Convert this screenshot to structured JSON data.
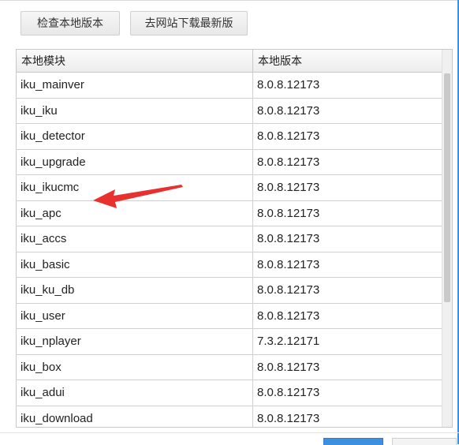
{
  "toolbar": {
    "check_local_label": "检查本地版本",
    "download_latest_label": "去网站下载最新版"
  },
  "table": {
    "columns": [
      "本地模块",
      "本地版本"
    ],
    "rows": [
      {
        "module": "iku_mainver",
        "version": "8.0.8.12173"
      },
      {
        "module": "iku_iku",
        "version": "8.0.8.12173"
      },
      {
        "module": "iku_detector",
        "version": "8.0.8.12173"
      },
      {
        "module": "iku_upgrade",
        "version": "8.0.8.12173"
      },
      {
        "module": "iku_ikucmc",
        "version": "8.0.8.12173"
      },
      {
        "module": "iku_apc",
        "version": "8.0.8.12173"
      },
      {
        "module": "iku_accs",
        "version": "8.0.8.12173"
      },
      {
        "module": "iku_basic",
        "version": "8.0.8.12173"
      },
      {
        "module": "iku_ku_db",
        "version": "8.0.8.12173"
      },
      {
        "module": "iku_user",
        "version": "8.0.8.12173"
      },
      {
        "module": "iku_nplayer",
        "version": "7.3.2.12171"
      },
      {
        "module": "iku_box",
        "version": "8.0.8.12173"
      },
      {
        "module": "iku_adui",
        "version": "8.0.8.12173"
      },
      {
        "module": "iku_download",
        "version": "8.0.8.12173"
      }
    ]
  },
  "colors": {
    "accent": "#3d8fe0",
    "annotation_arrow": "#e8312f"
  }
}
